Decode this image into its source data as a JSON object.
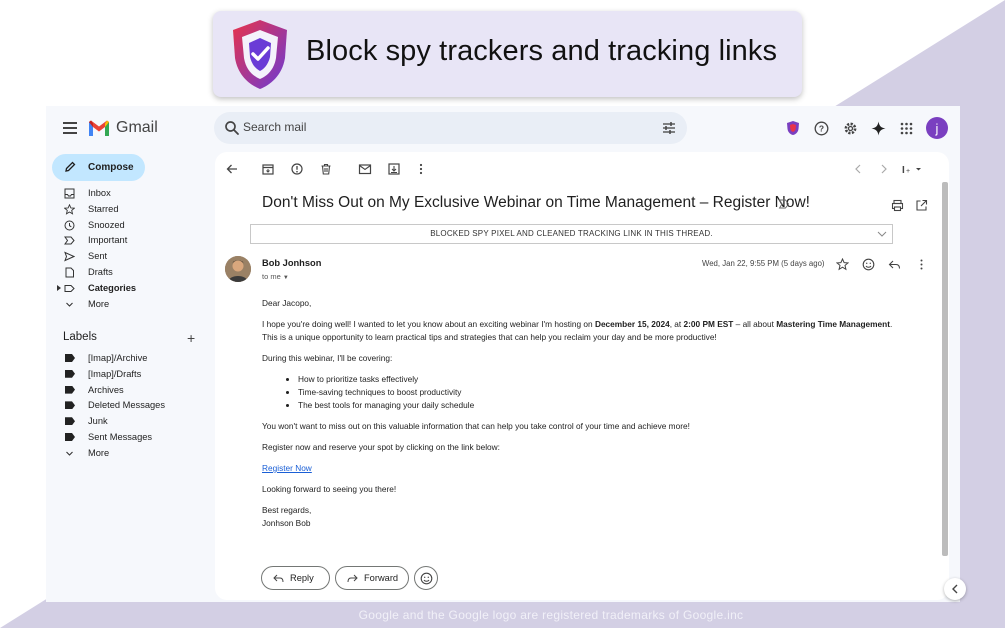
{
  "banner": {
    "title": "Block spy trackers and tracking links",
    "logo_icon": "shield-check-icon"
  },
  "app": {
    "brand": "Gmail",
    "search_placeholder": "Search mail",
    "avatar_letter": "j"
  },
  "sidebar": {
    "compose_label": "Compose",
    "items": [
      {
        "label": "Inbox",
        "icon": "inbox-icon"
      },
      {
        "label": "Starred",
        "icon": "star-icon"
      },
      {
        "label": "Snoozed",
        "icon": "clock-icon"
      },
      {
        "label": "Important",
        "icon": "important-icon"
      },
      {
        "label": "Sent",
        "icon": "send-icon"
      },
      {
        "label": "Drafts",
        "icon": "draft-icon"
      },
      {
        "label": "Categories",
        "icon": "label-outline-icon"
      },
      {
        "label": "More",
        "icon": "chevron-down-icon"
      }
    ],
    "labels_heading": "Labels",
    "labels": [
      "[Imap]/Archive",
      "[Imap]/Drafts",
      "Archives",
      "Deleted Messages",
      "Junk",
      "Sent Messages"
    ],
    "labels_more": "More"
  },
  "email": {
    "subject": "Don't Miss Out on My Exclusive Webinar on Time Management – Register Now!",
    "blocked_notice": "BLOCKED SPY PIXEL AND CLEANED TRACKING LINK IN THIS THREAD.",
    "sender": "Bob Jonhson",
    "to": "to me",
    "date": "Wed, Jan 22, 9:55 PM (5 days ago)",
    "greeting": "Dear Jacopo,",
    "p1_a": "I hope you're doing well! I wanted to let you know about an exciting webinar I'm hosting on ",
    "p1_date": "December 15, 2024",
    "p1_b": ", at ",
    "p1_time": "2:00 PM EST",
    "p1_c": " – all about ",
    "p1_topic": "Mastering Time Management",
    "p1_d": ".",
    "p1_line2": "This is a unique opportunity to learn practical tips and strategies that can help you reclaim your day and be more productive!",
    "p2": "During this webinar, I'll be covering:",
    "bullets": [
      "How to prioritize tasks effectively",
      "Time-saving techniques to boost productivity",
      "The best tools for managing your daily schedule"
    ],
    "p3": "You won't want to miss out on this valuable information that can help you take control of your time and achieve more!",
    "p4": "Register now and reserve your spot by clicking on the link below:",
    "link": "Register Now",
    "p5": "Looking forward to seeing you there!",
    "signoff": "Best regards,",
    "signature": "Jonhson Bob",
    "reply_label": "Reply",
    "forward_label": "Forward"
  },
  "footer": "Google and the Google logo are registered trademarks of Google.inc"
}
